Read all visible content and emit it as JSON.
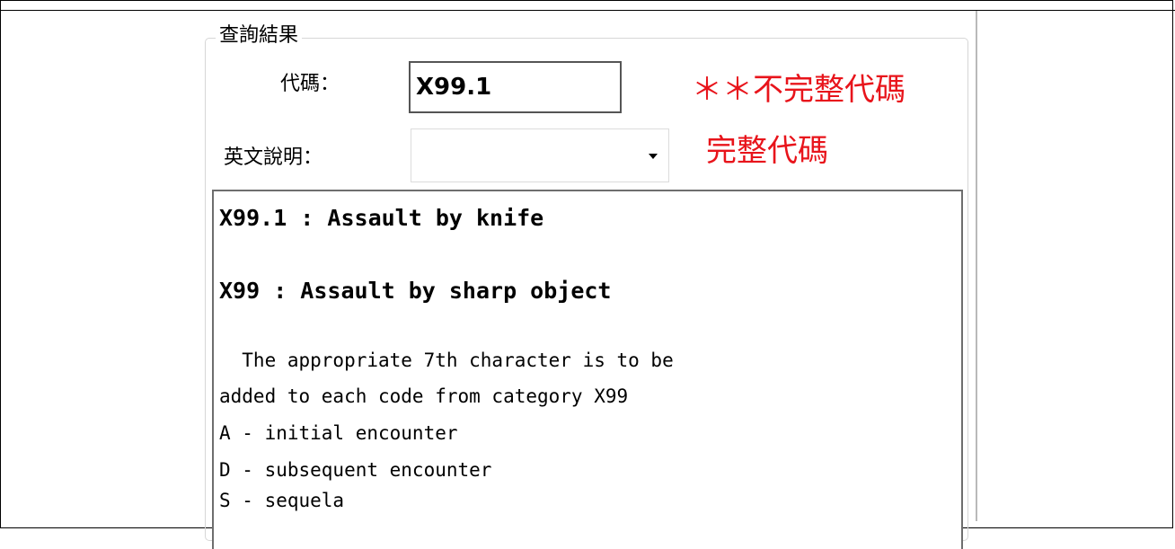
{
  "query_group": {
    "title": "查詢結果",
    "code_label": "代碼：",
    "code_value": "X99.1",
    "english_label": "英文說明：",
    "english_selected": "",
    "incomplete_note": "＊＊不完整代碼",
    "complete_note": "完整代碼"
  },
  "result": {
    "heading_1": "X99.1 : Assault by knife",
    "heading_2": "X99 : Assault by sharp object",
    "lines": [
      "  The appropriate 7th character is to be",
      "added to each code from category X99",
      "A - initial encounter",
      "D - subsequent encounter",
      "S - sequela"
    ]
  },
  "colors": {
    "note_red": "#e8141b",
    "border_gray": "#6e6e6e"
  }
}
